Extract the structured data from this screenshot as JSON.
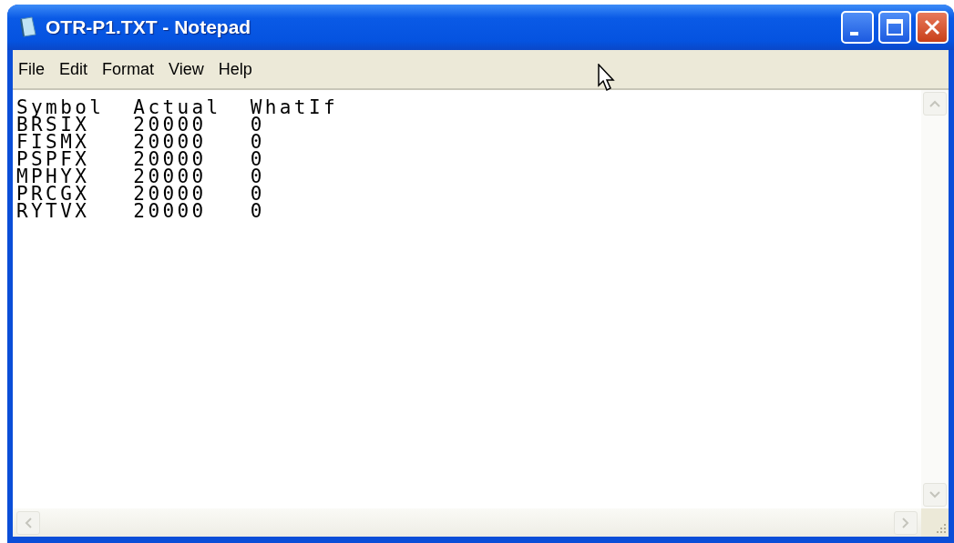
{
  "window": {
    "title": "OTR-P1.TXT - Notepad"
  },
  "menu": [
    "File",
    "Edit",
    "Format",
    "View",
    "Help"
  ],
  "document": {
    "lines": [
      "Symbol\tActual\tWhatIf",
      "BRSIX\t20000\t0",
      "FISMX\t20000\t0",
      "PSPFX\t20000\t0",
      "MPHYX\t20000\t0",
      "PRCGX\t20000\t0",
      "RYTVX\t20000\t0"
    ]
  }
}
